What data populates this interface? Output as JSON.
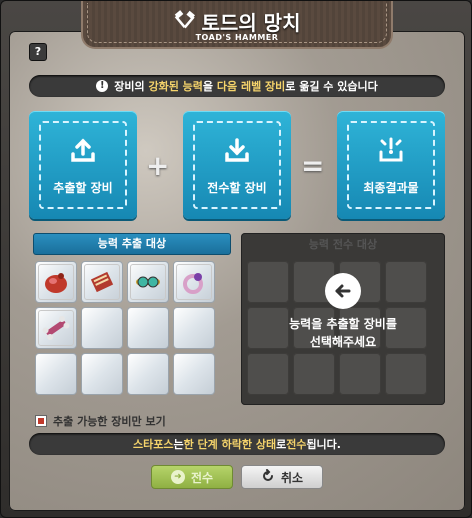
{
  "window": {
    "title": "토드의 망치",
    "subtitle": "TOAD'S HAMMER",
    "title_icon": "hammer-icon",
    "help_label": "?"
  },
  "notice": {
    "icon": "exclamation-icon",
    "parts": [
      "장비의 ",
      "강화된 능력",
      "을 ",
      "다음 레벨 장비",
      "로 ",
      "옮길 수 있습니다"
    ]
  },
  "slots": {
    "extract": {
      "label": "추출할 장비",
      "icon": "upload-icon"
    },
    "plus": "+",
    "transfer": {
      "label": "전수할 장비",
      "icon": "download-icon"
    },
    "equals": "=",
    "result": {
      "label": "최종결과물",
      "icon": "sparkle-box-icon"
    }
  },
  "extract_list": {
    "header": "능력 추출 대상",
    "items": [
      {
        "name": "red-crab-armor-item"
      },
      {
        "name": "red-book-item"
      },
      {
        "name": "goggles-item"
      },
      {
        "name": "purple-ring-item"
      },
      {
        "name": "pink-bone-weapon-item"
      },
      {
        "name": "empty"
      },
      {
        "name": "empty"
      },
      {
        "name": "empty"
      },
      {
        "name": "empty"
      },
      {
        "name": "empty"
      },
      {
        "name": "empty"
      },
      {
        "name": "empty"
      }
    ]
  },
  "target_list": {
    "header": "능력 전수 대상",
    "message_line1": "능력을 추출할 장비를",
    "message_line2": "선택해주세요",
    "icon": "arrow-left-icon"
  },
  "filter": {
    "label": "추출 가능한 장비만 보기",
    "checked": true
  },
  "info": {
    "parts": [
      "스타포스",
      "는 ",
      "한 단계 하락한 상태",
      "로 ",
      "전수",
      " 됩니다."
    ]
  },
  "buttons": {
    "transfer_label": "전수",
    "cancel_label": "취소"
  },
  "colors": {
    "accent_blue": "#1f9cc8",
    "highlight_yellow": "#f4d36b",
    "confirm_green": "#9dbd4f"
  }
}
